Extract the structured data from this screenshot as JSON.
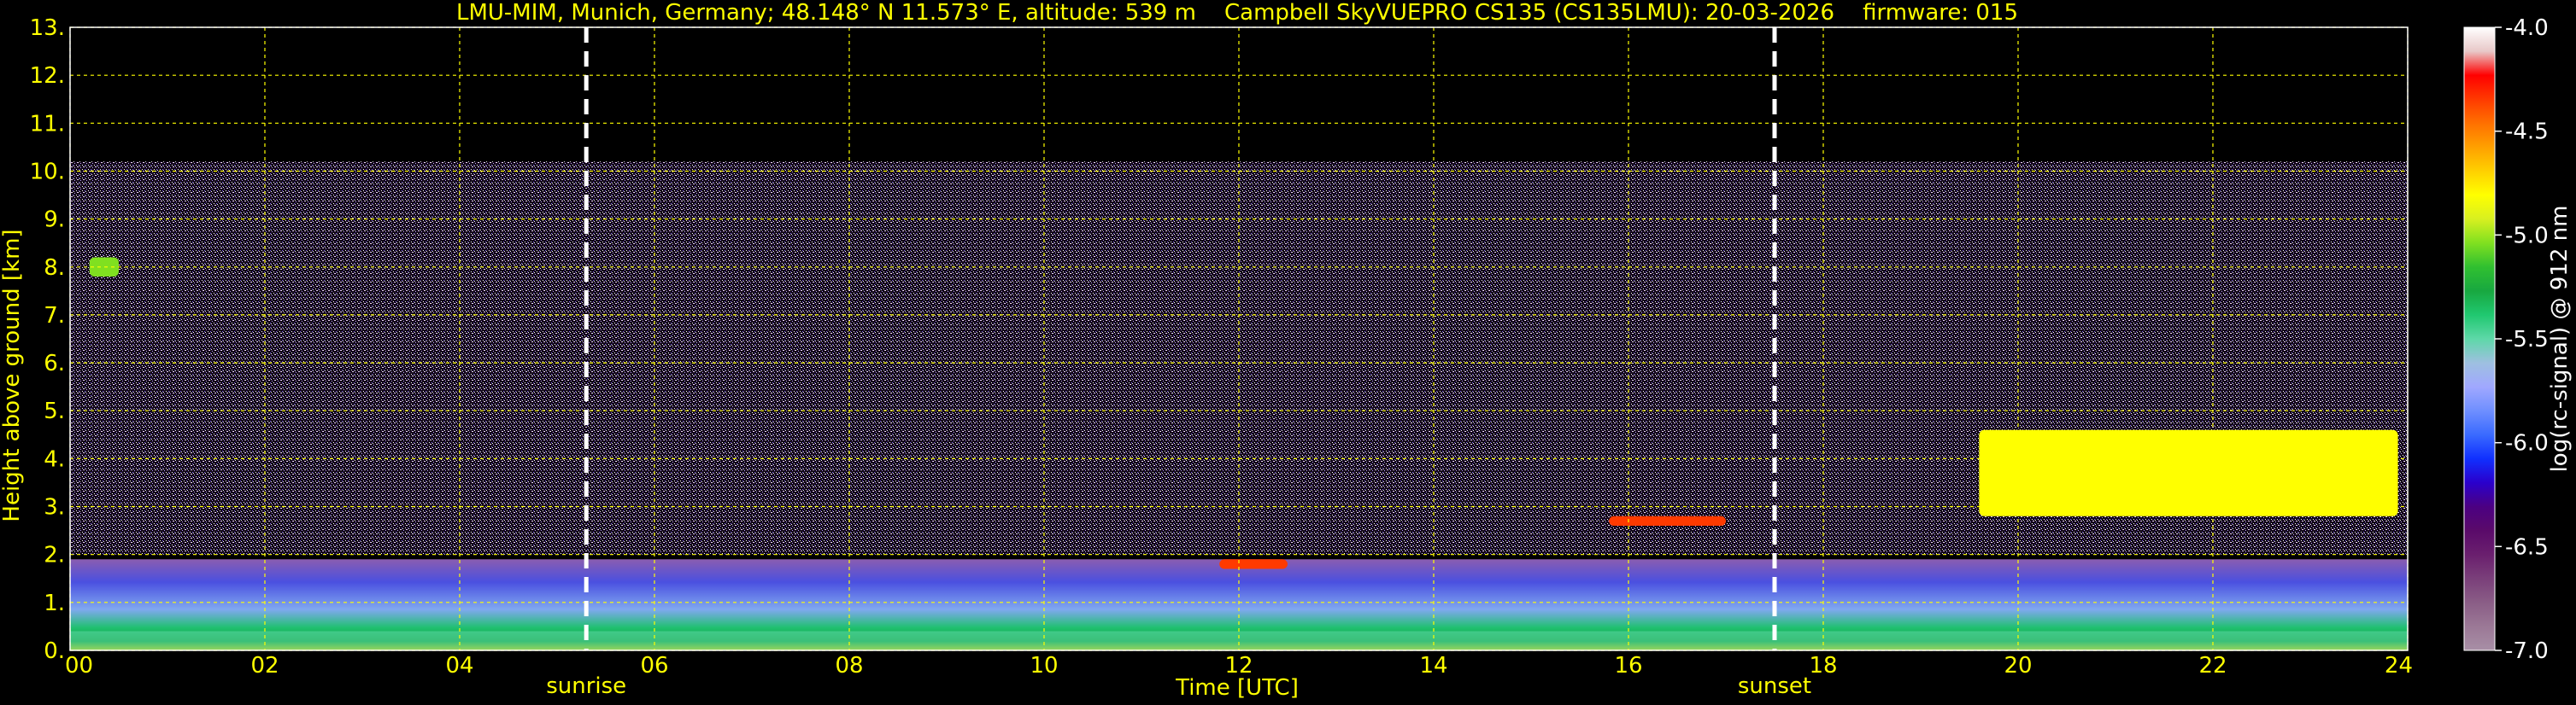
{
  "chart_data": {
    "type": "heatmap",
    "title": "LMU-MIM, Munich, Germany; 48.148° N 11.573° E, altitude: 539 m    Campbell SkyVUEPRO CS135 (CS135LMU): 20-03-2026    firmware: 015",
    "xlabel": "Time [UTC]",
    "ylabel": "Height above ground [km]",
    "xlim": [
      0,
      24
    ],
    "ylim": [
      0,
      13
    ],
    "x_ticks": [
      "00",
      "02",
      "04",
      "06",
      "08",
      "10",
      "12",
      "14",
      "16",
      "18",
      "20",
      "22",
      "24"
    ],
    "y_ticks": [
      "0.",
      "1.",
      "2.",
      "3.",
      "4.",
      "5.",
      "6.",
      "7.",
      "8.",
      "9.",
      "10.",
      "11.",
      "12.",
      "13."
    ],
    "grid": true,
    "grid_color": "#ffff00",
    "markers": [
      {
        "label": "sunrise",
        "time_utc": 5.3
      },
      {
        "label": "sunset",
        "time_utc": 17.5
      }
    ],
    "colorbar": {
      "label": "log(rc-signal) @ 912 nm",
      "range": [
        -7.0,
        -4.0
      ],
      "ticks": [
        "-4.0",
        "-4.5",
        "-5.0",
        "-5.5",
        "-6.0",
        "-6.5",
        "-7.0"
      ],
      "colors": [
        "#a88fa6",
        "#9b7896",
        "#8a5d86",
        "#7a3f7a",
        "#6a1f6e",
        "#5a0a6a",
        "#4b0082",
        "#2a00cc",
        "#1030ff",
        "#3a6aff",
        "#6f8fff",
        "#a0a8ff",
        "#9ec0e0",
        "#5ed8a8",
        "#20c870",
        "#18a840",
        "#30c030",
        "#80e020",
        "#d8f020",
        "#ffff00",
        "#ffd000",
        "#ffa000",
        "#ff7000",
        "#ff3a00",
        "#ff0000",
        "#e8c8c8",
        "#ffffff"
      ]
    },
    "layers": [
      {
        "name": "noise",
        "t": [
          0,
          24
        ],
        "z": [
          2.0,
          10.2
        ],
        "value": -6.3
      },
      {
        "name": "boundary_layer",
        "t": [
          0,
          24
        ],
        "z": [
          0,
          1.9
        ],
        "value": -5.9
      },
      {
        "name": "surface",
        "t": [
          0,
          24
        ],
        "z": [
          0,
          0.4
        ],
        "value": -5.5
      },
      {
        "name": "cloud_early",
        "t": [
          0.2,
          0.5
        ],
        "z": [
          7.8,
          8.2
        ],
        "value": -5.0
      },
      {
        "name": "cloud_12utc",
        "t": [
          11.8,
          12.5
        ],
        "z": [
          1.7,
          1.9
        ],
        "value": -4.3
      },
      {
        "name": "cloud_16utc",
        "t": [
          15.8,
          17.0
        ],
        "z": [
          2.6,
          2.8
        ],
        "value": -4.4
      },
      {
        "name": "cloud_evening",
        "t": [
          19.6,
          23.9
        ],
        "z": [
          2.8,
          4.6
        ],
        "value": -4.8
      }
    ]
  }
}
